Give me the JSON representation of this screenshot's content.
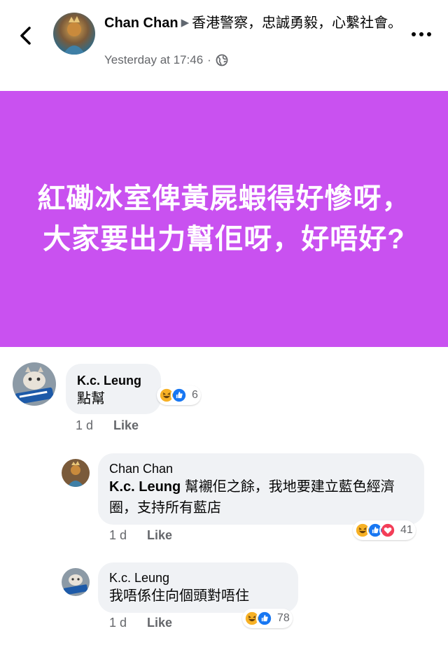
{
  "header": {
    "author": "Chan Chan",
    "group": "香港警察，忠誠勇毅，心繫社會。",
    "timestamp": "Yesterday at 17:46",
    "separator": "·",
    "privacy_icon": "globe-icon",
    "back_icon": "chevron-left-icon",
    "more_icon": "more-dots-icon"
  },
  "post": {
    "background_color": "#c951f0",
    "text_color": "#ffffff",
    "text": "紅磡冰室俾黃屍蝦得好慘呀，大家要出力幫佢呀，好唔好?"
  },
  "comments": [
    {
      "author": "K.c. Leung",
      "text": "點幫",
      "time": "1 d",
      "like_label": "Like",
      "reactions": [
        "haha-icon",
        "like-icon"
      ],
      "reaction_count": "6"
    },
    {
      "author": "Chan Chan",
      "mention": "K.c. Leung",
      "text": "幫襯佢之餘，我地要建立藍色經濟圈，支持所有藍店",
      "time": "1 d",
      "like_label": "Like",
      "reactions": [
        "haha-icon",
        "like-icon",
        "love-icon"
      ],
      "reaction_count": "41"
    },
    {
      "author": "K.c. Leung",
      "text": "我唔係住向個頭對唔住",
      "time": "1 d",
      "like_label": "Like",
      "reactions": [
        "haha-icon",
        "like-icon"
      ],
      "reaction_count": "78"
    }
  ],
  "colors": {
    "bubble": "#f0f2f5",
    "meta_text": "#65676b",
    "like_blue": "#1877f2",
    "love_red": "#f33e58",
    "haha_yellow": "#f7b125"
  }
}
